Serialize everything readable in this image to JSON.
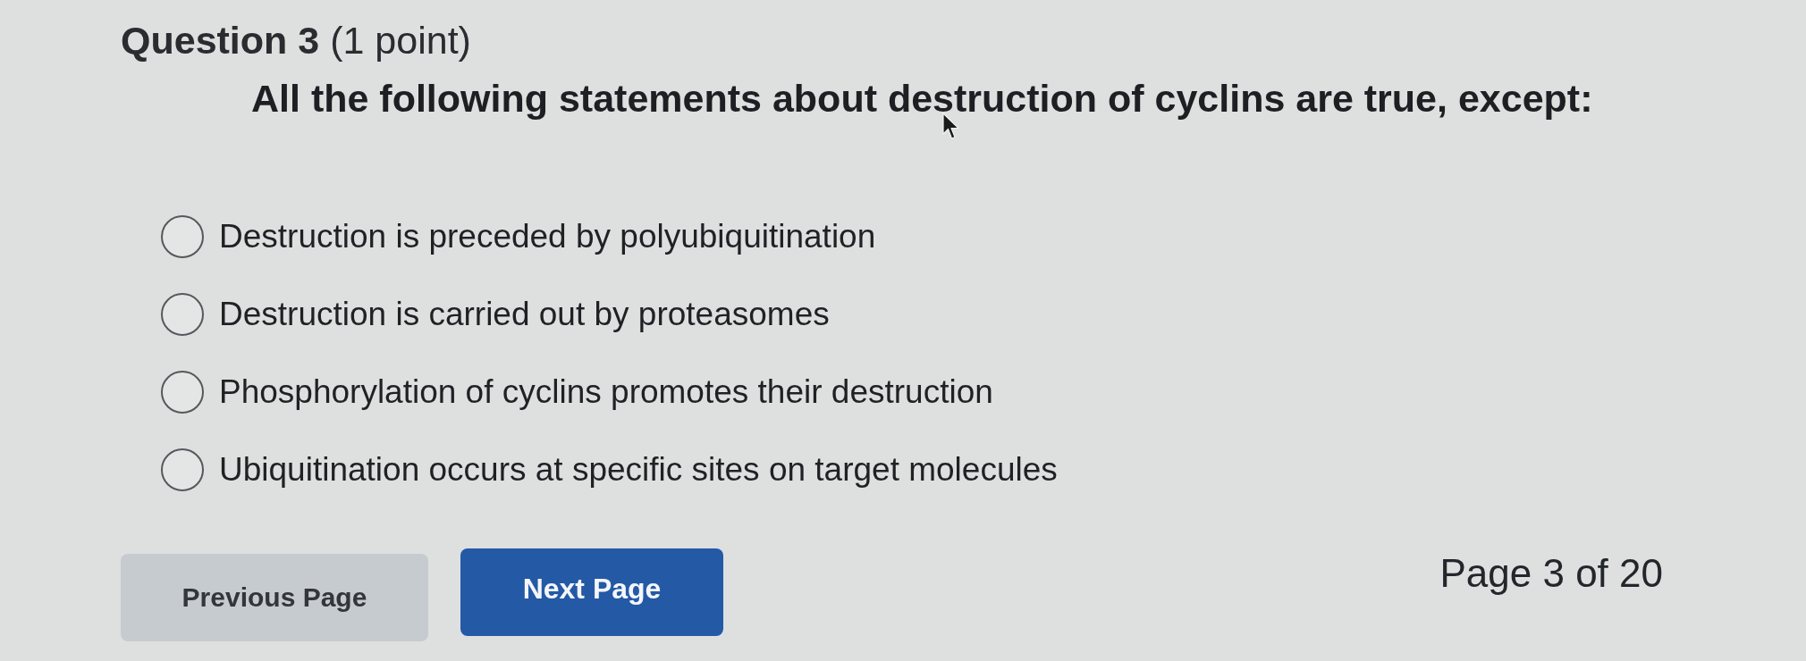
{
  "question": {
    "title": "**Question 3** (1 point)",
    "prompt": "All the following statements about destruction of cyclins are true, except:"
  },
  "options": [
    {
      "label": "Destruction is preceded by polyubiquitination",
      "selected": false
    },
    {
      "label": "Destruction is carried out by proteasomes",
      "selected": false
    },
    {
      "label": "Phosphorylation of cyclins promotes their destruction",
      "selected": false
    },
    {
      "label": "Ubiquitination occurs at specific sites on target molecules",
      "selected": false
    }
  ],
  "buttons": [
    {
      "label": "Previous Page",
      "kind": "secondary"
    },
    {
      "label": "Next Page",
      "kind": "primary"
    }
  ],
  "pagination": "Page 3 of 20"
}
